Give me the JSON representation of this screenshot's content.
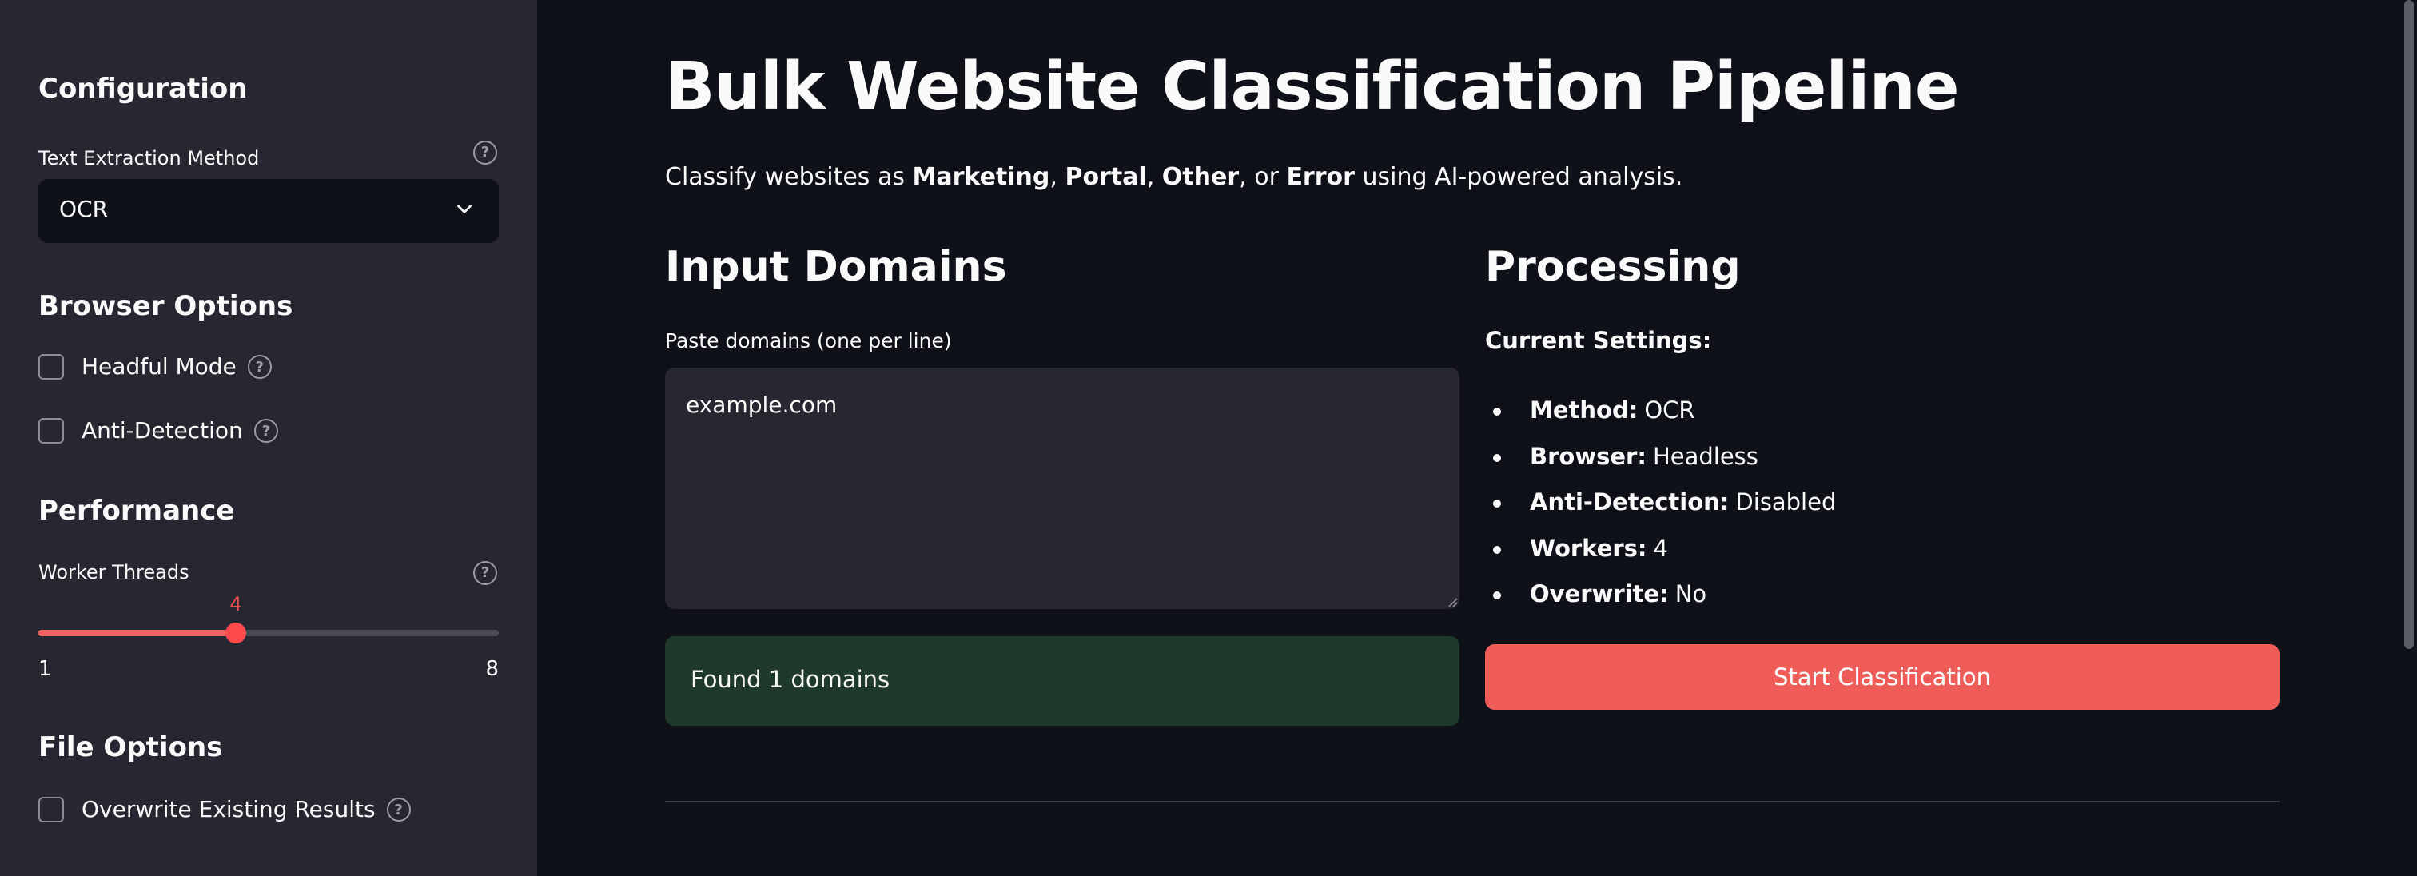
{
  "sidebar": {
    "configuration_heading": "Configuration",
    "text_extraction": {
      "label": "Text Extraction Method",
      "selected": "OCR"
    },
    "browser_options_heading": "Browser Options",
    "headful_mode": {
      "label": "Headful Mode",
      "checked": false
    },
    "anti_detection": {
      "label": "Anti-Detection",
      "checked": false
    },
    "performance_heading": "Performance",
    "worker_threads": {
      "label": "Worker Threads",
      "value": "4",
      "min": "1",
      "max": "8"
    },
    "file_options_heading": "File Options",
    "overwrite": {
      "label": "Overwrite Existing Results",
      "checked": false
    },
    "help_glyph": "?"
  },
  "main": {
    "title": "Bulk Website Classification Pipeline",
    "intro": {
      "prefix": "Classify websites as ",
      "marketing": "Marketing",
      "sep1": ", ",
      "portal": "Portal",
      "sep2": ", ",
      "other": "Other",
      "sep3": ", or ",
      "error": "Error",
      "suffix": " using AI-powered analysis."
    },
    "input_section": {
      "title": "Input Domains",
      "field_label": "Paste domains (one per line)",
      "textarea_value": "example.com",
      "status": "Found 1 domains"
    },
    "processing_section": {
      "title": "Processing",
      "settings_label": "Current Settings:",
      "settings": [
        {
          "key": "Method:",
          "value": "OCR"
        },
        {
          "key": "Browser:",
          "value": "Headless"
        },
        {
          "key": "Anti-Detection:",
          "value": "Disabled"
        },
        {
          "key": "Workers:",
          "value": "4"
        },
        {
          "key": "Overwrite:",
          "value": "No"
        }
      ],
      "start_button": "Start Classification"
    }
  },
  "colors": {
    "accent": "#ff4b4b",
    "button": "#f05c58",
    "success_bg": "#1f3a2b",
    "sidebar_bg": "#262730",
    "main_bg": "#0e1117"
  }
}
